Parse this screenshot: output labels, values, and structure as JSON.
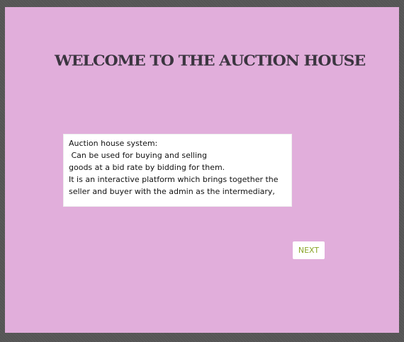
{
  "window": {
    "background_color": "#e1aedb"
  },
  "header": {
    "title": "WELCOME TO THE AUCTION HOUSE"
  },
  "description": {
    "lines": [
      "Auction house system:",
      " Can be used for buying and selling",
      "goods at a bid rate by bidding for them.",
      "It is an interactive platform which brings together the",
      "seller and buyer with the admin as the intermediary,"
    ]
  },
  "actions": {
    "next_label": "NEXT",
    "next_color": "#8aa52a"
  }
}
